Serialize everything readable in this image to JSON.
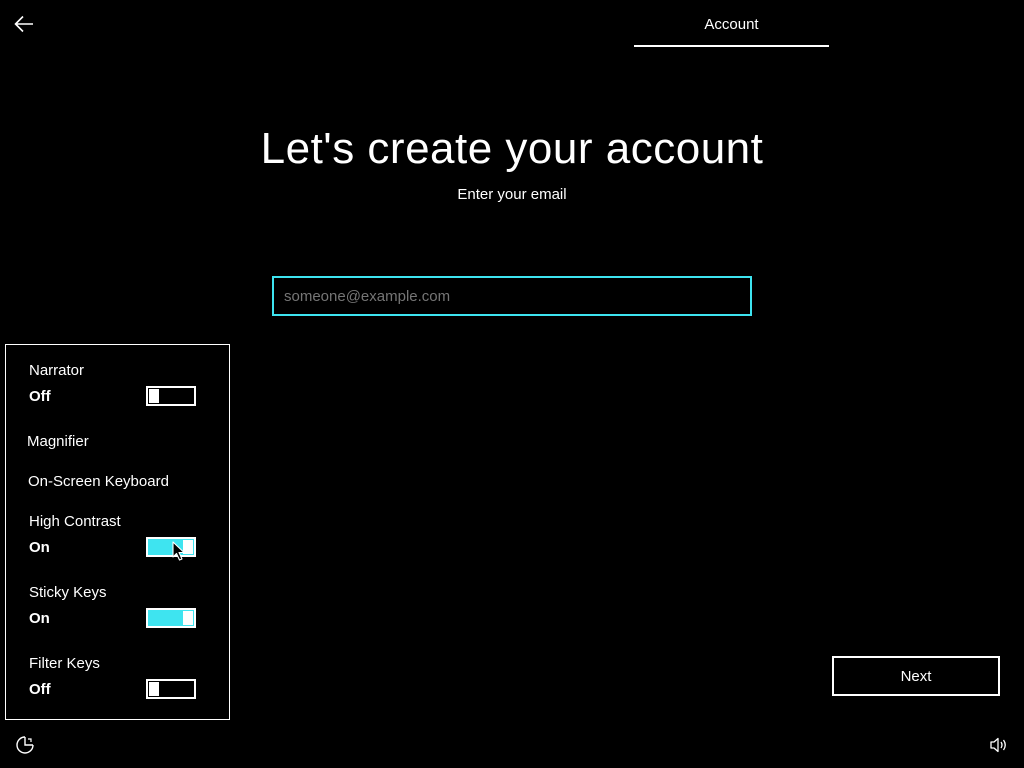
{
  "header": {
    "tab_label": "Account"
  },
  "main": {
    "title": "Let's create your account",
    "subtitle": "Enter your email",
    "email_placeholder": "someone@example.com",
    "next_label": "Next"
  },
  "accessibility_panel": {
    "items": [
      {
        "label": "Narrator",
        "state": "Off",
        "on": false
      },
      {
        "label": "Magnifier"
      },
      {
        "label": "On-Screen Keyboard"
      },
      {
        "label": "High Contrast",
        "state": "On",
        "on": true
      },
      {
        "label": "Sticky Keys",
        "state": "On",
        "on": true
      },
      {
        "label": "Filter Keys",
        "state": "Off",
        "on": false
      }
    ]
  },
  "icons": {
    "back": "back-arrow-icon",
    "ease_of_access": "ease-of-access-icon",
    "volume": "volume-icon",
    "cursor": "mouse-pointer-icon"
  },
  "colors": {
    "background": "#000000",
    "foreground": "#ffffff",
    "accent": "#3ee4f0"
  }
}
